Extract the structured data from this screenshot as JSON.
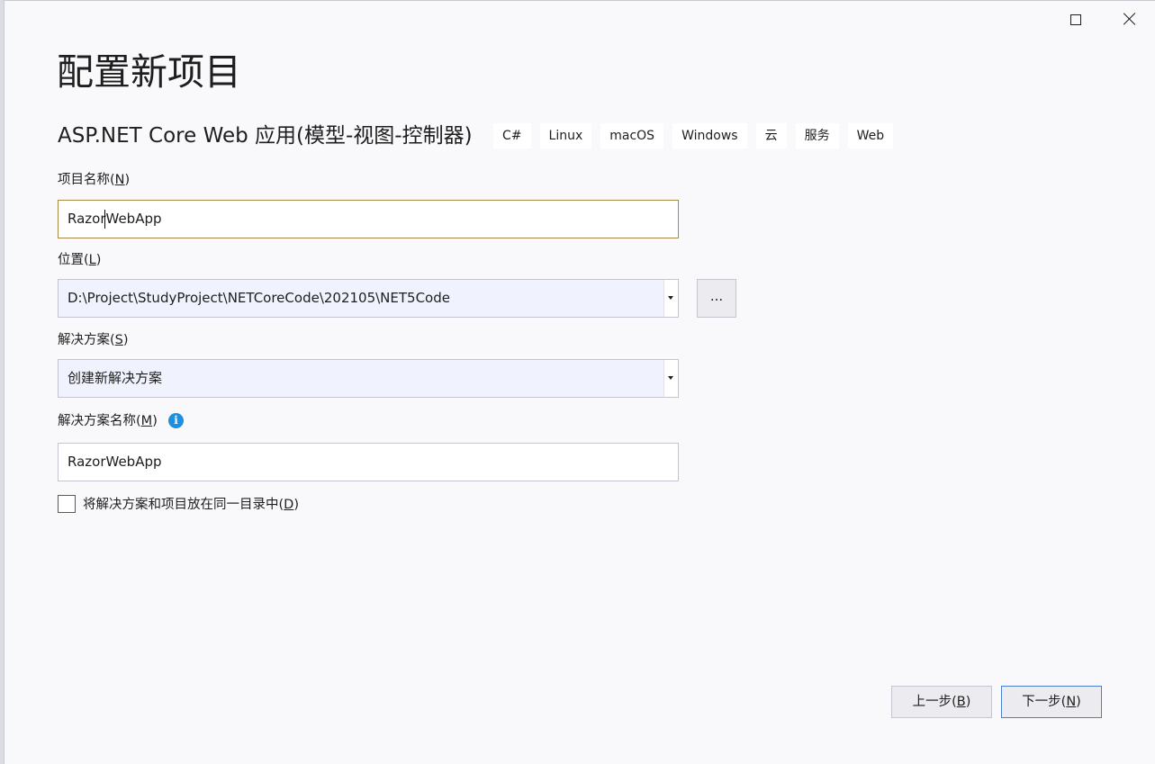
{
  "window": {
    "maximize_label": "maximize-icon",
    "close_label": "close-icon"
  },
  "header": {
    "title": "配置新项目",
    "template_name": "ASP.NET Core Web 应用(模型-视图-控制器)",
    "tags": [
      "C#",
      "Linux",
      "macOS",
      "Windows",
      "云",
      "服务",
      "Web"
    ]
  },
  "form": {
    "project_name": {
      "label_prefix": "项目名称(",
      "accel": "N",
      "label_suffix": ")",
      "value": "RazorWebApp"
    },
    "location": {
      "label_prefix": "位置(",
      "accel": "L",
      "label_suffix": ")",
      "value": "D:\\Project\\StudyProject\\NETCoreCode\\202105\\NET5Code",
      "browse_label": "..."
    },
    "solution": {
      "label_prefix": "解决方案(",
      "accel": "S",
      "label_suffix": ")",
      "value": "创建新解决方案"
    },
    "solution_name": {
      "label_prefix": "解决方案名称(",
      "accel": "M",
      "label_suffix": ")",
      "value": "RazorWebApp",
      "info_glyph": "i"
    },
    "same_directory": {
      "label_prefix": "将解决方案和项目放在同一目录中(",
      "accel": "D",
      "label_suffix": ")",
      "checked": false
    }
  },
  "footer": {
    "back": {
      "prefix": "上一步(",
      "accel": "B",
      "suffix": ")"
    },
    "next": {
      "prefix": "下一步(",
      "accel": "N",
      "suffix": ")"
    }
  }
}
